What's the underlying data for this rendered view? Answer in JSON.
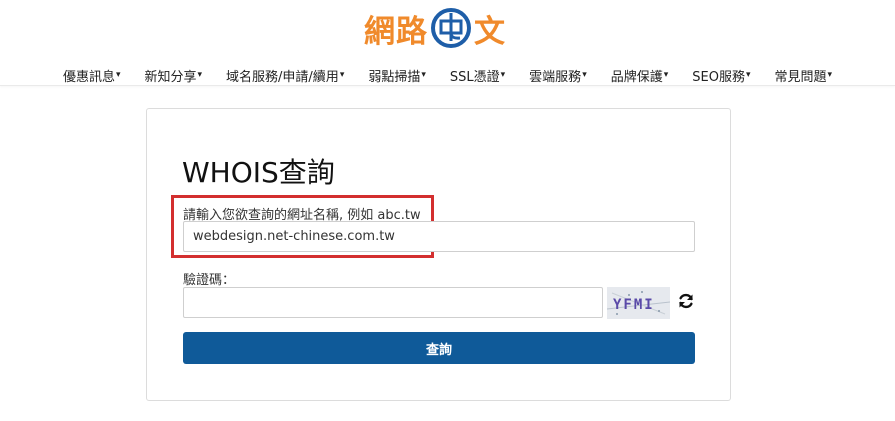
{
  "header": {
    "logo": {
      "text_left": "網路",
      "text_right": "文",
      "color": "#f08a2b",
      "mark_color": "#1e5ea8"
    },
    "nav": [
      {
        "label": "優惠訊息"
      },
      {
        "label": "新知分享"
      },
      {
        "label": "域名服務/申請/續用"
      },
      {
        "label": "弱點掃描"
      },
      {
        "label": "SSL憑證"
      },
      {
        "label": "雲端服務"
      },
      {
        "label": "品牌保護"
      },
      {
        "label": "SEO服務"
      },
      {
        "label": "常見問題"
      }
    ],
    "caret": "▾"
  },
  "form": {
    "title": "WHOIS查詢",
    "domain_label": "請輸入您欲查詢的網址名稱, 例如 abc.tw",
    "domain_value": "webdesign.net-chinese.com.tw",
    "captcha_label": "驗證碼：",
    "captcha_value": "",
    "captcha_text": "YFMI",
    "submit_label": "查詢",
    "accent_color": "#0f5a99",
    "highlight_color": "#d32f2f"
  }
}
